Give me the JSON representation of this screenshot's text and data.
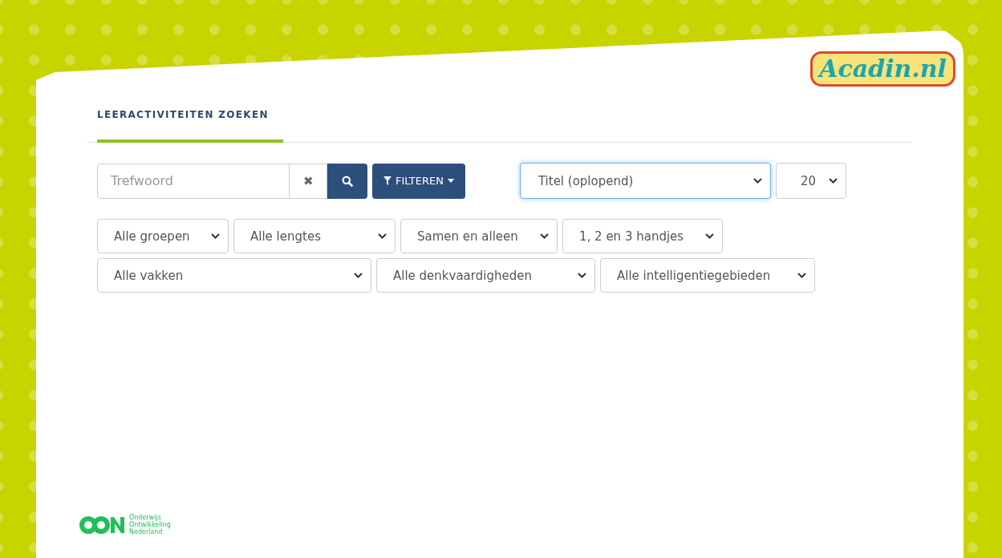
{
  "logo": {
    "text": "Acadin.nl"
  },
  "tabs": [
    {
      "label": "LEERACTIVITEITEN ZOEKEN",
      "selected": true
    }
  ],
  "search": {
    "placeholder": "Trefwoord",
    "clear_icon": "✖"
  },
  "filter_button": {
    "label": "FILTEREN"
  },
  "sort": {
    "value": "Titel (oplopend)",
    "focused": true
  },
  "page_size": {
    "value": "20",
    "focused": false
  },
  "filters": [
    [
      {
        "value": "Alle groepen"
      },
      {
        "value": "Alle lengtes"
      },
      {
        "value": "Samen en alleen"
      },
      {
        "value": "1, 2 en 3 handjes"
      }
    ],
    [
      {
        "value": "Alle vakken"
      },
      {
        "value": "Alle denkvaardigheden"
      },
      {
        "value": "Alle intelligentiegebieden"
      }
    ]
  ],
  "footer_logo": {
    "lines": [
      "Onderwijs",
      "Ontwikkeling",
      "Nederland"
    ]
  }
}
